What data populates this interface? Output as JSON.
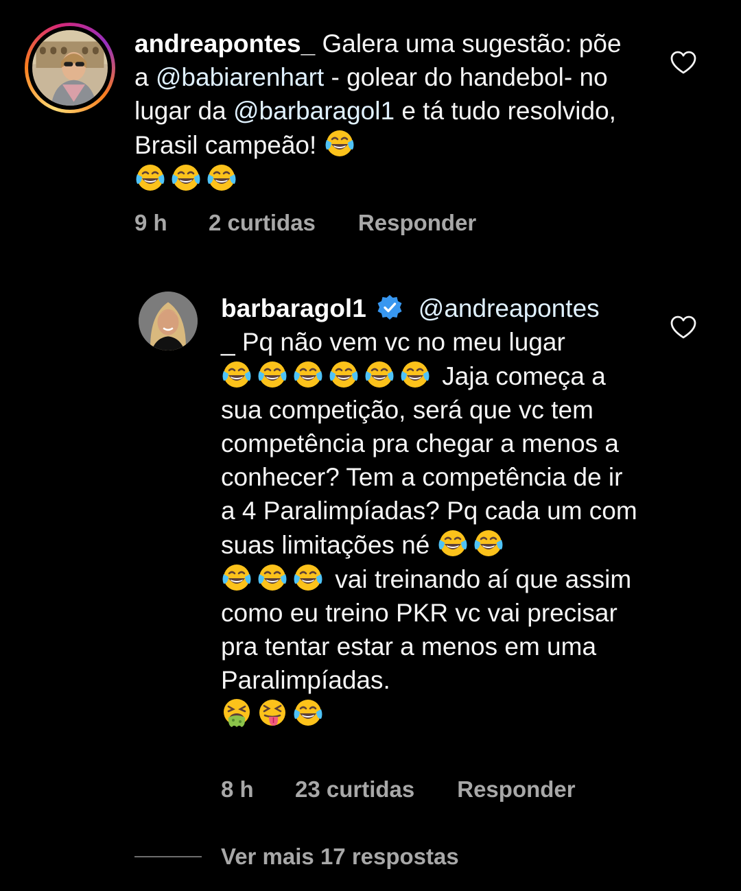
{
  "comments": [
    {
      "username": "andreapontes_",
      "text_parts": [
        " Galera uma sugestão: põe a ",
        "@babiarenhart",
        " - golear do handebol- no lugar da ",
        "@barbaragol1",
        " e tá tudo resolvido, Brasil campeão! "
      ],
      "emojis": [
        "face-with-tears-of-joy",
        "face-with-tears-of-joy",
        "face-with-tears-of-joy",
        "face-with-tears-of-joy"
      ],
      "time": "9 h",
      "likes": "2 curtidas",
      "reply_label": "Responder"
    },
    {
      "username": "barbaragol1",
      "verified": true,
      "mention": "@andreapontes",
      "line1_rest": "_ Pq não vem vc no meu lugar",
      "text_a": " Jaja começa a sua competição, será que vc tem competência pra chegar a menos a conhecer? Tem a competência de ir a 4 Paralimpíadas? Pq cada um com suas limitações né ",
      "text_b": " vai treinando aí que assim como eu treino PKR vc vai precisar pra tentar estar a menos em uma Paralimpíadas.",
      "emojis": [
        "face-with-tears-of-joy",
        "face-vomiting",
        "squinting-face-with-tongue"
      ],
      "time": "8 h",
      "likes": "23 curtidas",
      "reply_label": "Responder"
    }
  ],
  "view_more": "Ver mais 17 respostas",
  "colors": {
    "background": "#000000",
    "text": "#f5f5f5",
    "meta": "#a8a8a8",
    "mention": "#e0f1ff",
    "verified": "#3897f0"
  }
}
